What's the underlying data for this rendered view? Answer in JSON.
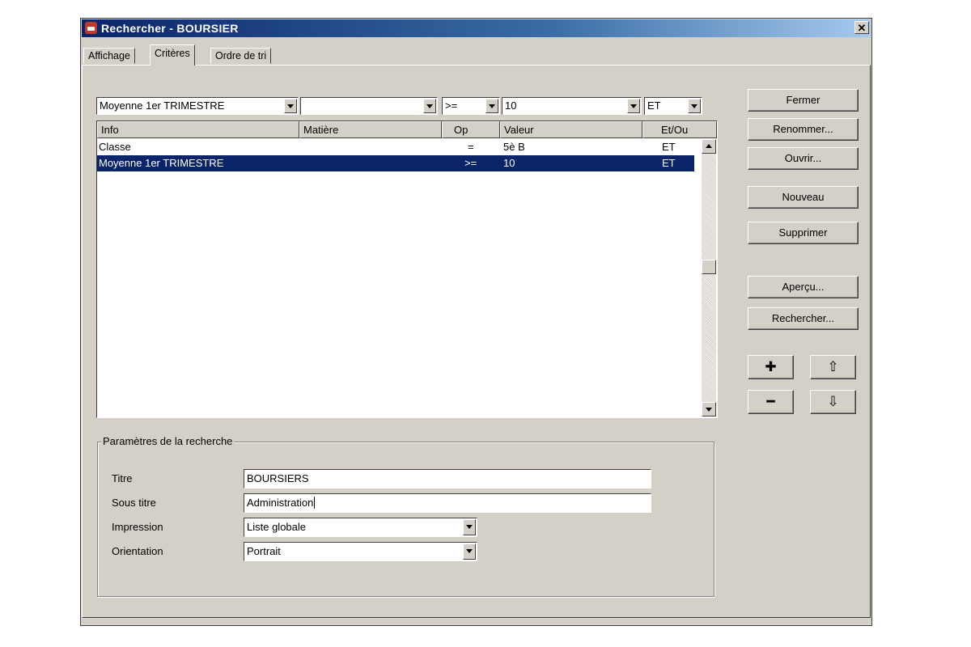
{
  "window": {
    "title": "Rechercher - BOURSIER",
    "close_symbol": "✕"
  },
  "tabs": [
    {
      "label": "Affichage"
    },
    {
      "label": "Critères"
    },
    {
      "label": "Ordre de tri"
    }
  ],
  "filter_row": {
    "info": "Moyenne 1er TRIMESTRE",
    "matiere": "",
    "op": ">=",
    "valeur": "10",
    "etou": "ET"
  },
  "criteria_table": {
    "columns": [
      "Info",
      "Matière",
      "Op",
      "Valeur",
      "Et/Ou"
    ],
    "rows": [
      {
        "info": "Classe",
        "matiere": "",
        "op": "=",
        "valeur": "5è B",
        "etou": "ET"
      },
      {
        "info": "Moyenne 1er TRIMESTRE",
        "matiere": "",
        "op": ">=",
        "valeur": "10",
        "etou": "ET"
      }
    ],
    "selected_row": 1
  },
  "buttons": {
    "fermer": "Fermer",
    "renommer": "Renommer...",
    "ouvrir": "Ouvrir...",
    "nouveau": "Nouveau",
    "supprimer": "Supprimer",
    "apercu": "Aperçu...",
    "rechercher": "Rechercher..."
  },
  "small_buttons": {
    "add": "✚",
    "remove": "━",
    "move_up": "⇧",
    "move_down": "⇩"
  },
  "params": {
    "legend": "Paramètres de la recherche",
    "titre_label": "Titre",
    "titre_value": "BOURSIERS",
    "sous_titre_label": "Sous titre",
    "sous_titre_value": "Administration",
    "impression_label": "Impression",
    "impression_value": "Liste globale",
    "orientation_label": "Orientation",
    "orientation_value": "Portrait"
  },
  "colors": {
    "selection": "#0a246a",
    "face": "#d4d0c8",
    "titlebar": "#0a246a"
  }
}
